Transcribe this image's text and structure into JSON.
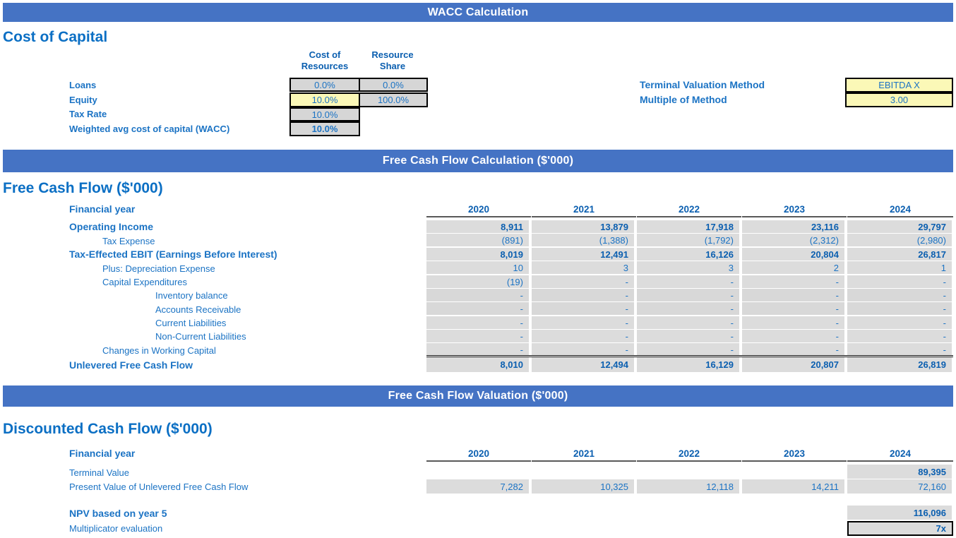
{
  "banners": {
    "wacc": "WACC Calculation",
    "fcf_calc": "Free Cash Flow Calculation ($'000)",
    "fcf_val": "Free Cash Flow Valuation ($'000)"
  },
  "cost_of_capital": {
    "title": "Cost of Capital",
    "col_headers": [
      "Cost of Resources",
      "Resource Share"
    ],
    "col_header_lines": {
      "c1l1": "Cost of",
      "c1l2": "Resources",
      "c2l1": "Resource",
      "c2l2": "Share"
    },
    "rows": [
      {
        "label": "Loans",
        "cost_of_resources": "0.0%",
        "resource_share": "0.0%"
      },
      {
        "label": "Equity",
        "cost_of_resources": "10.0%",
        "resource_share": "100.0%"
      },
      {
        "label": "Tax Rate",
        "cost_of_resources": "10.0%",
        "resource_share": ""
      },
      {
        "label": "Weighted avg cost of capital (WACC)",
        "cost_of_resources": "10.0%",
        "resource_share": ""
      }
    ],
    "terminal": {
      "method_label": "Terminal Valuation Method",
      "method_value": "EBITDA X",
      "multiple_label": "Multiple of Method",
      "multiple_value": "3.00"
    }
  },
  "free_cash_flow": {
    "title": "Free Cash Flow ($'000)",
    "financial_year_label": "Financial year",
    "years": [
      "2020",
      "2021",
      "2022",
      "2023",
      "2024"
    ],
    "rows": [
      {
        "label": "Operating Income",
        "style": "bold",
        "indent": 0,
        "values": [
          "8,911",
          "13,879",
          "17,918",
          "23,116",
          "29,797"
        ]
      },
      {
        "label": "Tax Expense",
        "style": "normal",
        "indent": 1,
        "values": [
          "(891)",
          "(1,388)",
          "(1,792)",
          "(2,312)",
          "(2,980)"
        ]
      },
      {
        "label": "Tax-Effected EBIT (Earnings Before Interest)",
        "style": "bold",
        "indent": 0,
        "values": [
          "8,019",
          "12,491",
          "16,126",
          "20,804",
          "26,817"
        ]
      },
      {
        "label": "Plus: Depreciation Expense",
        "style": "normal",
        "indent": 1,
        "values": [
          "10",
          "3",
          "3",
          "2",
          "1"
        ]
      },
      {
        "label": "Capital Expenditures",
        "style": "normal",
        "indent": 1,
        "values": [
          "(19)",
          "-",
          "-",
          "-",
          "-"
        ]
      },
      {
        "label": "Inventory balance",
        "style": "normal",
        "indent": 2,
        "values": [
          "-",
          "-",
          "-",
          "-",
          "-"
        ]
      },
      {
        "label": "Accounts Receivable",
        "style": "normal",
        "indent": 2,
        "values": [
          "-",
          "-",
          "-",
          "-",
          "-"
        ]
      },
      {
        "label": "Current Liabilities",
        "style": "normal",
        "indent": 2,
        "values": [
          "-",
          "-",
          "-",
          "-",
          "-"
        ]
      },
      {
        "label": "Non-Current Liabilities",
        "style": "normal",
        "indent": 2,
        "values": [
          "-",
          "-",
          "-",
          "-",
          "-"
        ]
      },
      {
        "label": "Changes in Working Capital",
        "style": "normal",
        "indent": 1,
        "values": [
          "-",
          "-",
          "-",
          "-",
          "-"
        ]
      }
    ],
    "total_row": {
      "label": "Unlevered Free Cash Flow",
      "values": [
        "8,010",
        "12,494",
        "16,129",
        "20,807",
        "26,819"
      ]
    }
  },
  "discounted_cash_flow": {
    "title": "Discounted Cash Flow ($'000)",
    "financial_year_label": "Financial year",
    "years": [
      "2020",
      "2021",
      "2022",
      "2023",
      "2024"
    ],
    "rows": [
      {
        "label": "Terminal Value",
        "style": "normal",
        "values": [
          "",
          "",
          "",
          "",
          "89,395"
        ]
      },
      {
        "label": "Present Value of Unlevered Free Cash Flow",
        "style": "normal",
        "values": [
          "7,282",
          "10,325",
          "12,118",
          "14,211",
          "72,160"
        ]
      }
    ],
    "npv": {
      "label": "NPV based on year 5",
      "value": "116,096"
    },
    "multiplicator": {
      "label": "Multiplicator evaluation",
      "value": "7x"
    }
  },
  "colors": {
    "banner_blue": "#4573C4",
    "text_blue": "#1B73C4",
    "heading_blue": "#0B6FC4",
    "cell_gray": "#DCDCDC",
    "input_yellow": "#FBF8B7"
  }
}
